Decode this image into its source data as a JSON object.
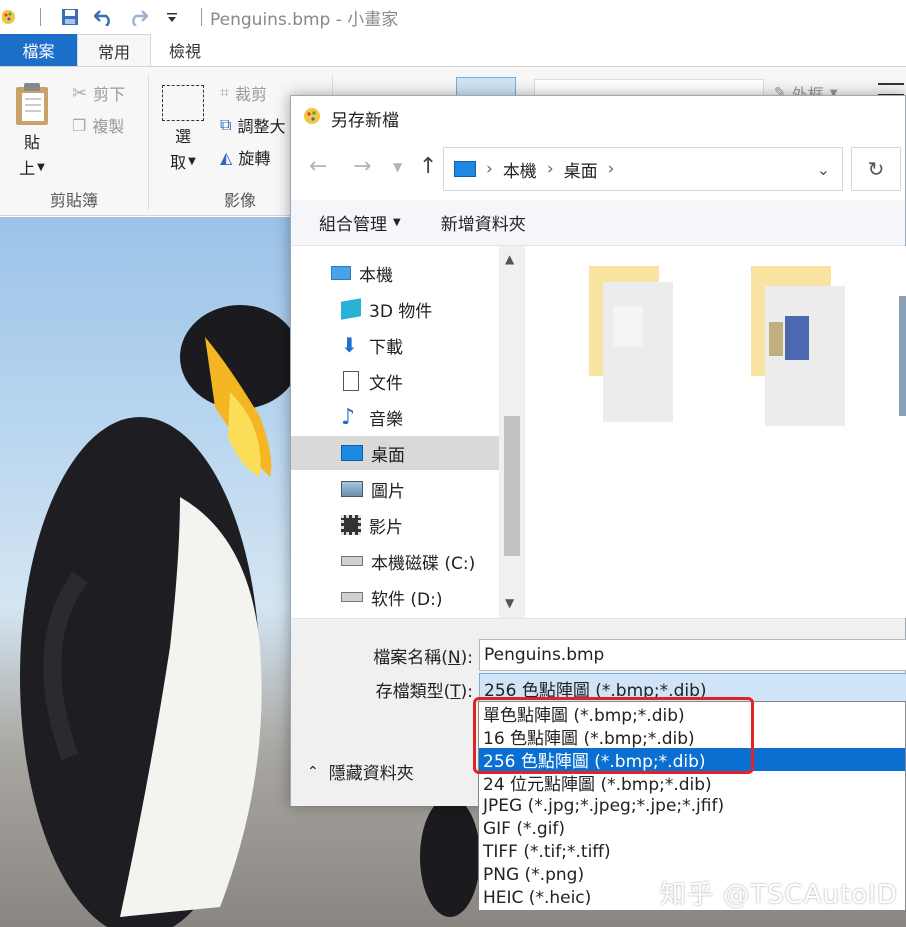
{
  "window": {
    "title": "Penguins.bmp - 小畫家"
  },
  "ribbon": {
    "tabs": [
      "檔案",
      "常用",
      "檢視"
    ],
    "clipboard": {
      "paste_label": "貼",
      "paste_sub": "上",
      "cut": "剪下",
      "copy": "複製",
      "group": "剪貼簿"
    },
    "image": {
      "select_label": "選",
      "select_sub": "取",
      "crop": "裁剪",
      "resize": "調整大",
      "rotate": "旋轉",
      "group": "影像"
    },
    "outline": "外框"
  },
  "dialog": {
    "title": "另存新檔",
    "breadcrumb": [
      "本機",
      "桌面"
    ],
    "organize": "組合管理",
    "new_folder": "新增資料夾",
    "nav_items": [
      "本機",
      "3D 物件",
      "下載",
      "文件",
      "音樂",
      "桌面",
      "圖片",
      "影片",
      "本機磁碟 (C:)",
      "软件 (D:)"
    ],
    "selected_nav": "桌面",
    "filename_label": "檔案名稱(",
    "filename_key": "N",
    "filename_label_end": "):",
    "filename_value": "Penguins.bmp",
    "filetype_label": "存檔類型(",
    "filetype_key": "T",
    "filetype_label_end": "):",
    "filetype_value": "256 色點陣圖 (*.bmp;*.dib)",
    "hide_folders": "隱藏資料夾"
  },
  "filetype_options": [
    "單色點陣圖 (*.bmp;*.dib)",
    "16 色點陣圖 (*.bmp;*.dib)",
    "256 色點陣圖 (*.bmp;*.dib)",
    "24 位元點陣圖 (*.bmp;*.dib)",
    "JPEG (*.jpg;*.jpeg;*.jpe;*.jfif)",
    "GIF (*.gif)",
    "TIFF (*.tif;*.tiff)",
    "PNG (*.png)",
    "HEIC (*.heic)"
  ],
  "selected_option_index": 2,
  "watermark": "知乎 @TSCAutoID",
  "colors": {
    "file_tab": "#1c6fc9",
    "selection": "#0a6fd0",
    "highlight_box": "#e02424"
  }
}
